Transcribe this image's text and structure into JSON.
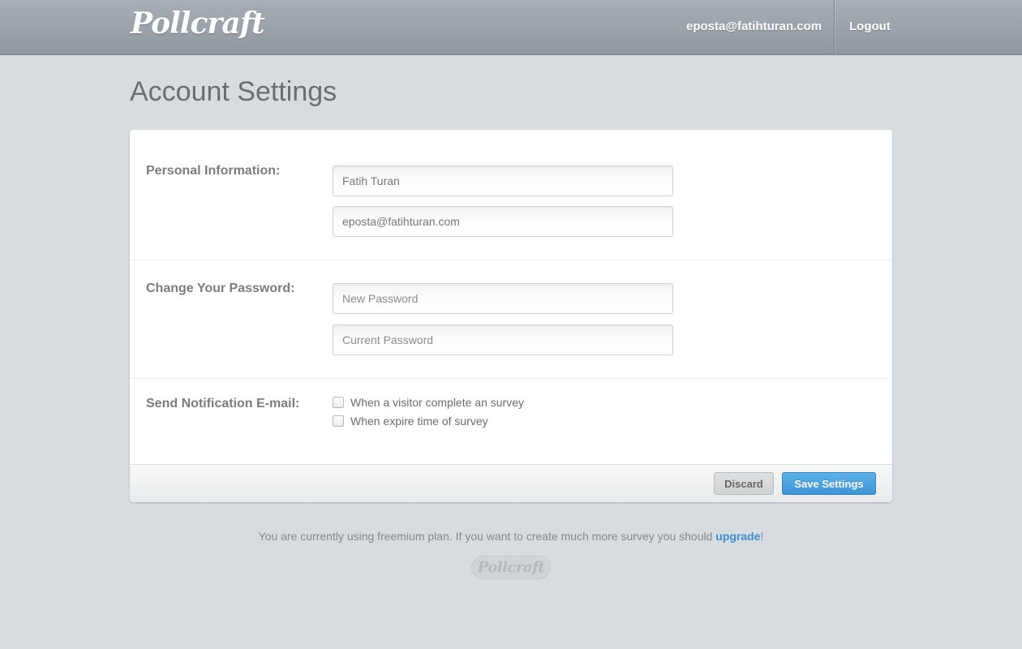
{
  "header": {
    "logo": "Pollcraft",
    "user_email": "eposta@fatihturan.com",
    "logout_label": "Logout"
  },
  "page": {
    "title": "Account Settings"
  },
  "personal": {
    "label": "Personal Information:",
    "name_value": "Fatih Turan",
    "email_value": "eposta@fatihturan.com"
  },
  "password": {
    "label": "Change Your Password:",
    "new_placeholder": "New Password",
    "current_placeholder": "Current Password"
  },
  "notifications": {
    "label": "Send Notification E-mail:",
    "options": [
      {
        "label": "When a visitor complete an survey",
        "checked": false
      },
      {
        "label": "When expire time of survey",
        "checked": false
      }
    ]
  },
  "actions": {
    "discard_label": "Discard",
    "save_label": "Save Settings"
  },
  "footer": {
    "note_text": "You are currently using freemium plan. If you want to create much more survey you should ",
    "upgrade_link": "upgrade",
    "note_end": "!",
    "logo": "Pollcraft"
  },
  "colors": {
    "background": "#d7dce1",
    "accent": "#3f8fd0",
    "save_button": "#4ba3e0"
  }
}
